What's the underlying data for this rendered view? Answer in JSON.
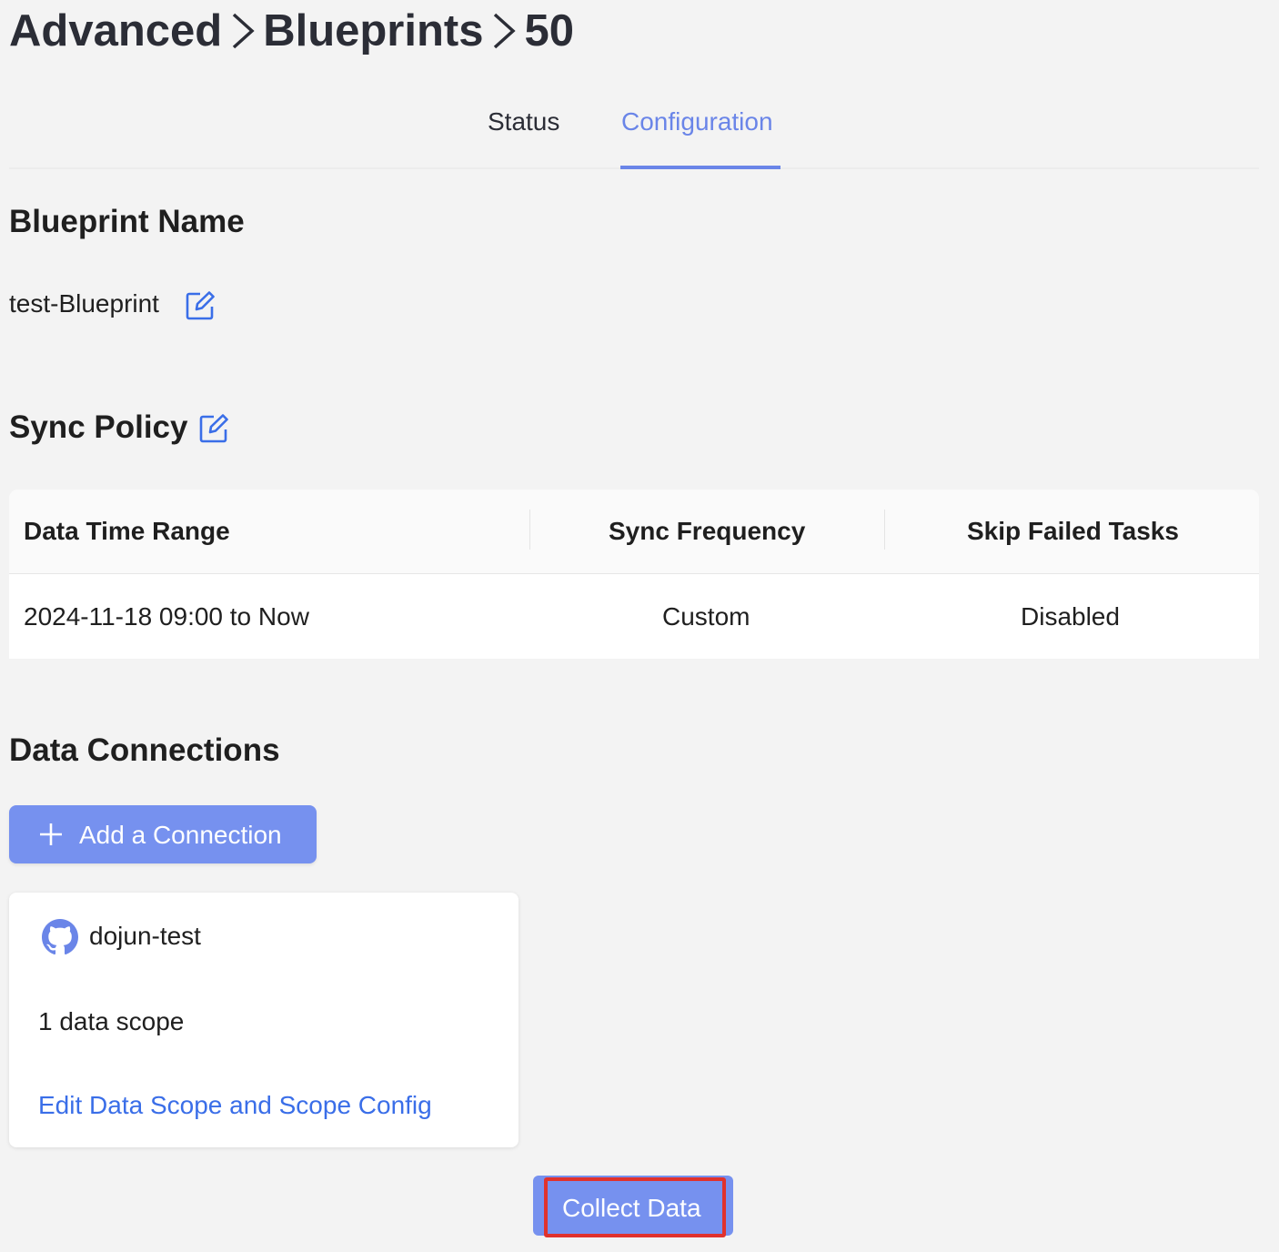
{
  "breadcrumb": {
    "items": [
      "Advanced",
      "Blueprints",
      "50"
    ],
    "separator_icon": "chevron-right-icon"
  },
  "tabs": [
    {
      "label": "Status",
      "active": false
    },
    {
      "label": "Configuration",
      "active": true
    }
  ],
  "blueprint_name": {
    "title": "Blueprint Name",
    "value": "test-Blueprint",
    "edit_icon": "edit-icon"
  },
  "sync_policy": {
    "title": "Sync Policy",
    "edit_icon": "edit-icon",
    "columns": [
      "Data Time Range",
      "Sync Frequency",
      "Skip Failed Tasks"
    ],
    "row": [
      "2024-11-18 09:00 to Now",
      "Custom",
      "Disabled"
    ]
  },
  "data_connections": {
    "title": "Data Connections",
    "add_button_label": "Add a Connection",
    "add_button_icon": "plus-icon",
    "connections": [
      {
        "icon": "github-icon",
        "name": "dojun-test",
        "scope_count": "1 data scope",
        "edit_link": "Edit Data Scope and Scope Config"
      }
    ]
  },
  "collect_button_label": "Collect Data",
  "colors": {
    "accent": "#7691ef",
    "active_tab": "#6a85e8",
    "link": "#3a6ee8",
    "highlight_border": "#e0322d",
    "background": "#f3f3f3"
  }
}
